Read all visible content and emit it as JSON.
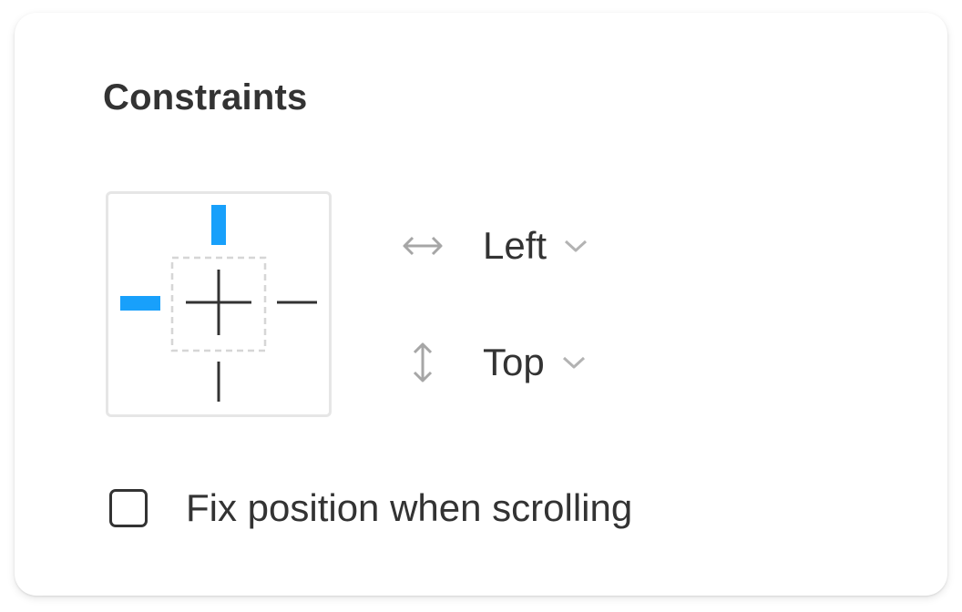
{
  "panel": {
    "title": "Constraints"
  },
  "constraint_widget": {
    "active_sides": [
      "top",
      "left"
    ],
    "inactive_sides": [
      "right",
      "bottom"
    ],
    "active_color": "#18a0fb",
    "inactive_color": "#333333"
  },
  "horizontal": {
    "icon": "horizontal-arrows-icon",
    "value": "Left"
  },
  "vertical": {
    "icon": "vertical-arrows-icon",
    "value": "Top"
  },
  "fix_position": {
    "label": "Fix position when scrolling",
    "checked": false
  }
}
